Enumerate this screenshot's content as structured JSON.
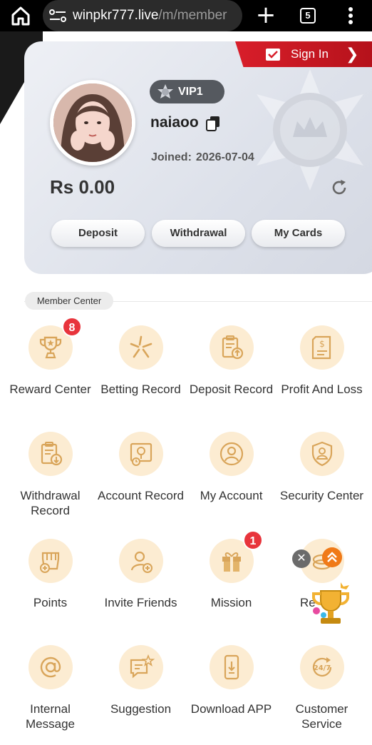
{
  "browser": {
    "url_host": "winpkr777.live",
    "url_path": "/m/member",
    "tab_count": "5",
    "new_tab_label": "+"
  },
  "header": {
    "signin_label": "Sign In",
    "signin_arrow": "❯"
  },
  "profile": {
    "vip_level": "VIP1",
    "username": "naiaoo",
    "joined_label": "Joined:",
    "joined_date": "2026-07-04",
    "balance": "Rs 0.00"
  },
  "actions": {
    "deposit": "Deposit",
    "withdrawal": "Withdrawal",
    "my_cards": "My Cards"
  },
  "member_center": {
    "title": "Member Center",
    "items": [
      {
        "label": "Reward Center",
        "badge": "8",
        "icon": "trophy-icon"
      },
      {
        "label": "Betting Record",
        "badge": "",
        "icon": "betting-icon"
      },
      {
        "label": "Deposit Record",
        "badge": "",
        "icon": "deposit-record-icon"
      },
      {
        "label": "Profit And Loss",
        "badge": "",
        "icon": "profit-loss-icon"
      },
      {
        "label": "Withdrawal Record",
        "badge": "",
        "icon": "withdrawal-record-icon"
      },
      {
        "label": "Account Record",
        "badge": "",
        "icon": "account-record-icon"
      },
      {
        "label": "My Account",
        "badge": "",
        "icon": "user-icon"
      },
      {
        "label": "Security Center",
        "badge": "",
        "icon": "shield-user-icon"
      },
      {
        "label": "Points",
        "badge": "",
        "icon": "points-icon"
      },
      {
        "label": "Invite Friends",
        "badge": "",
        "icon": "invite-icon"
      },
      {
        "label": "Mission",
        "badge": "1",
        "icon": "gift-icon"
      },
      {
        "label": "Re",
        "badge": "",
        "icon": "rebate-icon"
      },
      {
        "label": "Internal Message",
        "badge": "",
        "icon": "at-icon"
      },
      {
        "label": "Suggestion",
        "badge": "",
        "icon": "suggestion-icon"
      },
      {
        "label": "Download APP",
        "badge": "",
        "icon": "download-icon"
      },
      {
        "label": "Customer Service",
        "badge": "",
        "icon": "support-24-7-icon"
      }
    ]
  },
  "floating": {
    "close": "✕"
  },
  "colors": {
    "accent_gold": "#d9a55a",
    "icon_bg": "#fcecd2",
    "signin_red": "#d81e2a",
    "badge_red": "#e8343c"
  }
}
